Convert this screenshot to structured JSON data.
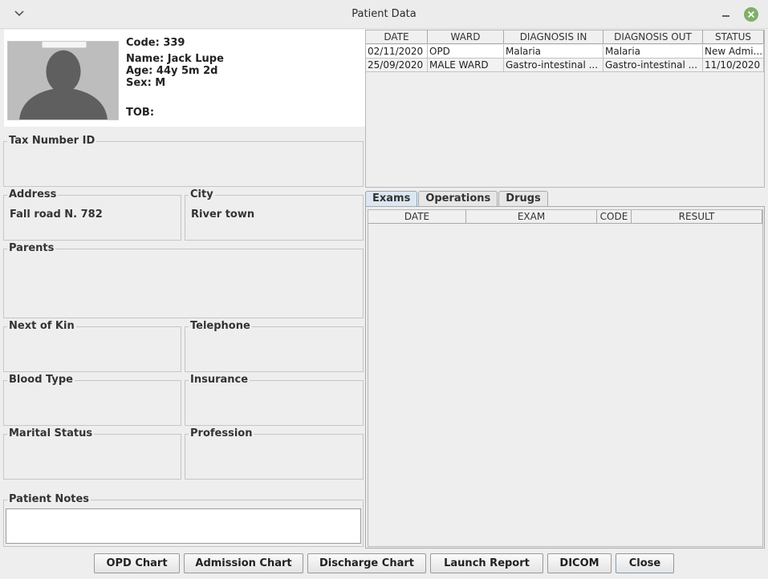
{
  "window": {
    "title": "Patient Data"
  },
  "summary": {
    "code": "Code: 339",
    "name": "Name: Jack Lupe",
    "age": "Age: 44y 5m 2d",
    "sex": "Sex: M",
    "tob": "TOB:"
  },
  "fields": {
    "tax_number": {
      "label": "Tax Number ID",
      "value": ""
    },
    "address": {
      "label": "Address",
      "value": "Fall road N. 782"
    },
    "city": {
      "label": "City",
      "value": "River town"
    },
    "parents": {
      "label": "Parents",
      "value": ""
    },
    "next_of_kin": {
      "label": "Next of Kin",
      "value": ""
    },
    "telephone": {
      "label": "Telephone",
      "value": ""
    },
    "blood_type": {
      "label": "Blood Type",
      "value": ""
    },
    "insurance": {
      "label": "Insurance",
      "value": ""
    },
    "marital_status": {
      "label": "Marital Status",
      "value": ""
    },
    "profession": {
      "label": "Profession",
      "value": ""
    },
    "patient_notes": {
      "label": "Patient Notes",
      "value": ""
    }
  },
  "admissions": {
    "columns": [
      "DATE",
      "WARD",
      "DIAGNOSIS IN",
      "DIAGNOSIS OUT",
      "STATUS"
    ],
    "rows": [
      [
        "02/11/2020",
        "OPD",
        "Malaria",
        "Malaria",
        "New Admi..."
      ],
      [
        "25/09/2020",
        "MALE WARD",
        "Gastro-intestinal ...",
        "Gastro-intestinal ...",
        "11/10/2020"
      ]
    ]
  },
  "tabs": [
    {
      "label": "Exams",
      "active": true
    },
    {
      "label": "Operations",
      "active": false
    },
    {
      "label": "Drugs",
      "active": false
    }
  ],
  "exams": {
    "columns": [
      "DATE",
      "EXAM",
      "CODE",
      "RESULT"
    ]
  },
  "buttons": {
    "opd_chart": "OPD Chart",
    "admission_chart": "Admission Chart",
    "discharge_chart": "Discharge Chart",
    "launch_report": "Launch Report",
    "dicom": "DICOM",
    "close": "Close"
  },
  "colors": {
    "background": "#eeeeee",
    "active_tab": "#dce7f2",
    "close_button": "#7fb069"
  }
}
